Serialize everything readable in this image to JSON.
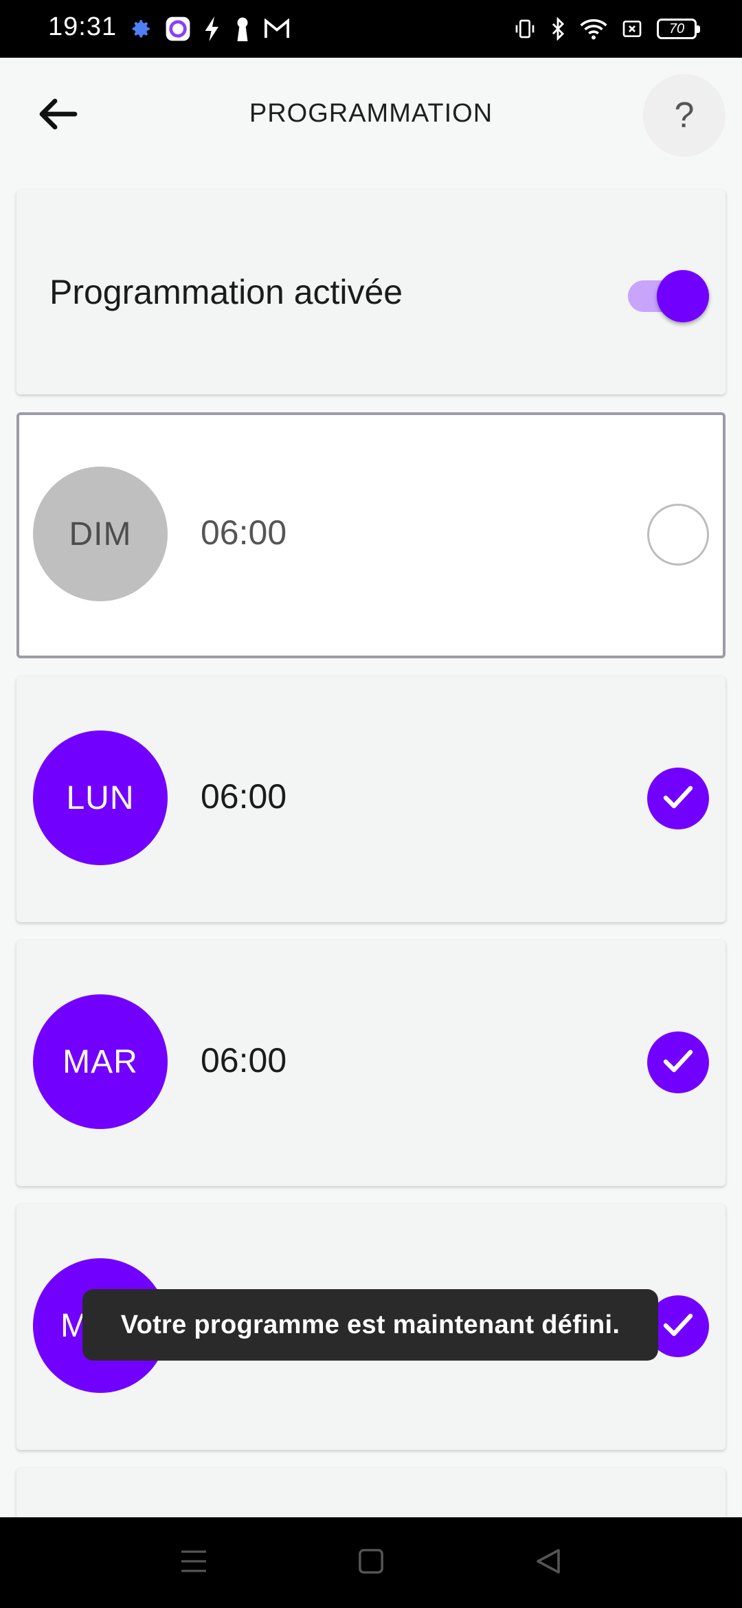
{
  "status_bar": {
    "time": "19:31",
    "battery_level": "70",
    "left_icons": [
      "gear-icon",
      "app-circle-icon",
      "flash-icon",
      "keyhole-icon",
      "gmail-icon"
    ],
    "right_icons": [
      "vibrate-icon",
      "bluetooth-icon",
      "wifi-icon",
      "no-sim-icon",
      "battery-icon"
    ]
  },
  "app_bar": {
    "title": "PROGRAMMATION",
    "back_icon": "arrow-left-icon",
    "help_label": "?"
  },
  "schedule_toggle": {
    "label": "Programmation activée",
    "enabled": true
  },
  "days": [
    {
      "day": "DIM",
      "time": "06:00",
      "checked": false,
      "selected": true
    },
    {
      "day": "LUN",
      "time": "06:00",
      "checked": true,
      "selected": false
    },
    {
      "day": "MAR",
      "time": "06:00",
      "checked": true,
      "selected": false
    },
    {
      "day": "M",
      "time": "",
      "checked": true,
      "selected": false
    }
  ],
  "toast": {
    "message": "Votre programme est maintenant défini."
  },
  "nav_bar": {
    "icons": [
      "menu-icon",
      "home-icon",
      "back-triangle-icon"
    ]
  },
  "colors": {
    "accent": "#7200ff",
    "accent_light": "#c8a4fb",
    "inactive_day": "#bfbfbf",
    "card_background": "#f3f4f4",
    "toast_background": "#2a2a2a"
  }
}
